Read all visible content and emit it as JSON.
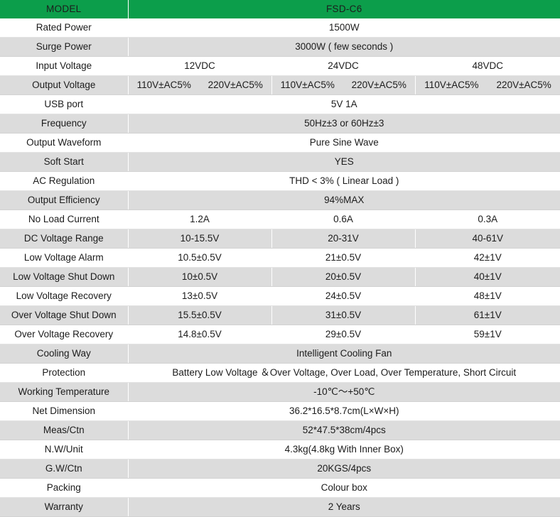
{
  "header": {
    "model_label": "MODEL",
    "model_value": "FSD-C6"
  },
  "colors": {
    "header_green": "#0c9e4b",
    "row_gray": "#dcdcdc",
    "row_white": "#ffffff",
    "text": "#1c1c1c"
  },
  "rows": [
    {
      "label": "Rated Power",
      "span": "full",
      "values": [
        "1500W"
      ]
    },
    {
      "label": "Surge Power",
      "span": "full",
      "values": [
        "3000W ( few seconds )"
      ]
    },
    {
      "label": "Input Voltage",
      "span": "three",
      "values": [
        "12VDC",
        "24VDC",
        "48VDC"
      ]
    },
    {
      "label": "Output Voltage",
      "span": "dual3",
      "values": [
        [
          "110V±AC5%",
          "220V±AC5%"
        ],
        [
          "110V±AC5%",
          "220V±AC5%"
        ],
        [
          "110V±AC5%",
          "220V±AC5%"
        ]
      ]
    },
    {
      "label": "USB port",
      "span": "full",
      "values": [
        "5V 1A"
      ]
    },
    {
      "label": "Frequency",
      "span": "full",
      "values": [
        "50Hz±3 or 60Hz±3"
      ]
    },
    {
      "label": "Output Waveform",
      "span": "full",
      "values": [
        "Pure Sine Wave"
      ]
    },
    {
      "label": "Soft Start",
      "span": "full",
      "values": [
        "YES"
      ]
    },
    {
      "label": "AC Regulation",
      "span": "full",
      "values": [
        "THD < 3% ( Linear Load )"
      ]
    },
    {
      "label": "Output Efficiency",
      "span": "full",
      "values": [
        "94%MAX"
      ]
    },
    {
      "label": "No Load Current",
      "span": "three",
      "values": [
        "1.2A",
        "0.6A",
        "0.3A"
      ]
    },
    {
      "label": "DC Voltage Range",
      "span": "three",
      "values": [
        "10-15.5V",
        "20-31V",
        "40-61V"
      ]
    },
    {
      "label": "Low Voltage Alarm",
      "span": "three",
      "values": [
        "10.5±0.5V",
        "21±0.5V",
        "42±1V"
      ]
    },
    {
      "label": "Low Voltage Shut Down",
      "span": "three",
      "values": [
        "10±0.5V",
        "20±0.5V",
        "40±1V"
      ]
    },
    {
      "label": "Low Voltage Recovery",
      "span": "three",
      "values": [
        "13±0.5V",
        "24±0.5V",
        "48±1V"
      ]
    },
    {
      "label": "Over Voltage Shut Down",
      "span": "three",
      "values": [
        "15.5±0.5V",
        "31±0.5V",
        "61±1V"
      ]
    },
    {
      "label": "Over Voltage Recovery",
      "span": "three",
      "values": [
        "14.8±0.5V",
        "29±0.5V",
        "59±1V"
      ]
    },
    {
      "label": "Cooling Way",
      "span": "full",
      "values": [
        "Intelligent Cooling Fan"
      ]
    },
    {
      "label": "Protection",
      "span": "full",
      "values": [
        "Battery Low Voltage ＆Over Voltage, Over Load, Over Temperature, Short Circuit"
      ]
    },
    {
      "label": "Working Temperature",
      "span": "full",
      "values": [
        "-10℃～+50℃"
      ]
    },
    {
      "label": "Net Dimension",
      "span": "full",
      "values": [
        "36.2*16.5*8.7cm(L×W×H)"
      ]
    },
    {
      "label": "Meas/Ctn",
      "span": "full",
      "values": [
        "52*47.5*38cm/4pcs"
      ]
    },
    {
      "label": "N.W/Unit",
      "span": "full",
      "values": [
        "4.3kg(4.8kg With Inner Box)"
      ]
    },
    {
      "label": "G.W/Ctn",
      "span": "full",
      "values": [
        "20KGS/4pcs"
      ]
    },
    {
      "label": "Packing",
      "span": "full",
      "values": [
        "Colour box"
      ]
    },
    {
      "label": "Warranty",
      "span": "full",
      "values": [
        "2 Years"
      ]
    }
  ]
}
